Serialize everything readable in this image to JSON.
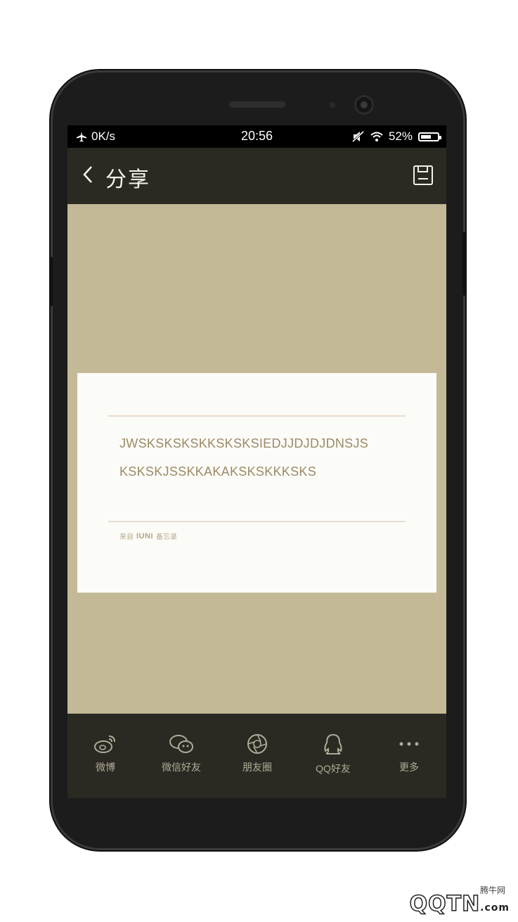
{
  "status_bar": {
    "network_speed": "0K/s",
    "time": "20:56",
    "battery": "52%"
  },
  "header": {
    "title": "分享"
  },
  "card": {
    "line1": "JWSKSKSKSKKSKSKSIEDJJDJDJDNSJS",
    "line2": "KSKSKJSSKKAKAKSKSKKKSKS",
    "footer_prefix": "来自",
    "footer_brand": "IUNI",
    "footer_app": "备忘录"
  },
  "share": {
    "items": [
      {
        "label": "微博",
        "icon": "weibo-icon"
      },
      {
        "label": "微信好友",
        "icon": "wechat-icon"
      },
      {
        "label": "朋友圈",
        "icon": "moments-icon"
      },
      {
        "label": "QQ好友",
        "icon": "qq-icon"
      },
      {
        "label": "更多",
        "icon": "more-icon"
      }
    ]
  },
  "watermark": {
    "site": "腾牛网",
    "logo": "QQTN",
    "suffix": ".com"
  },
  "colors": {
    "header_bg": "#2b2a22",
    "content_bg": "#c3b996",
    "card_bg": "#fbfbf8",
    "card_text": "#9c8a66",
    "share_label": "#b0aa98"
  }
}
